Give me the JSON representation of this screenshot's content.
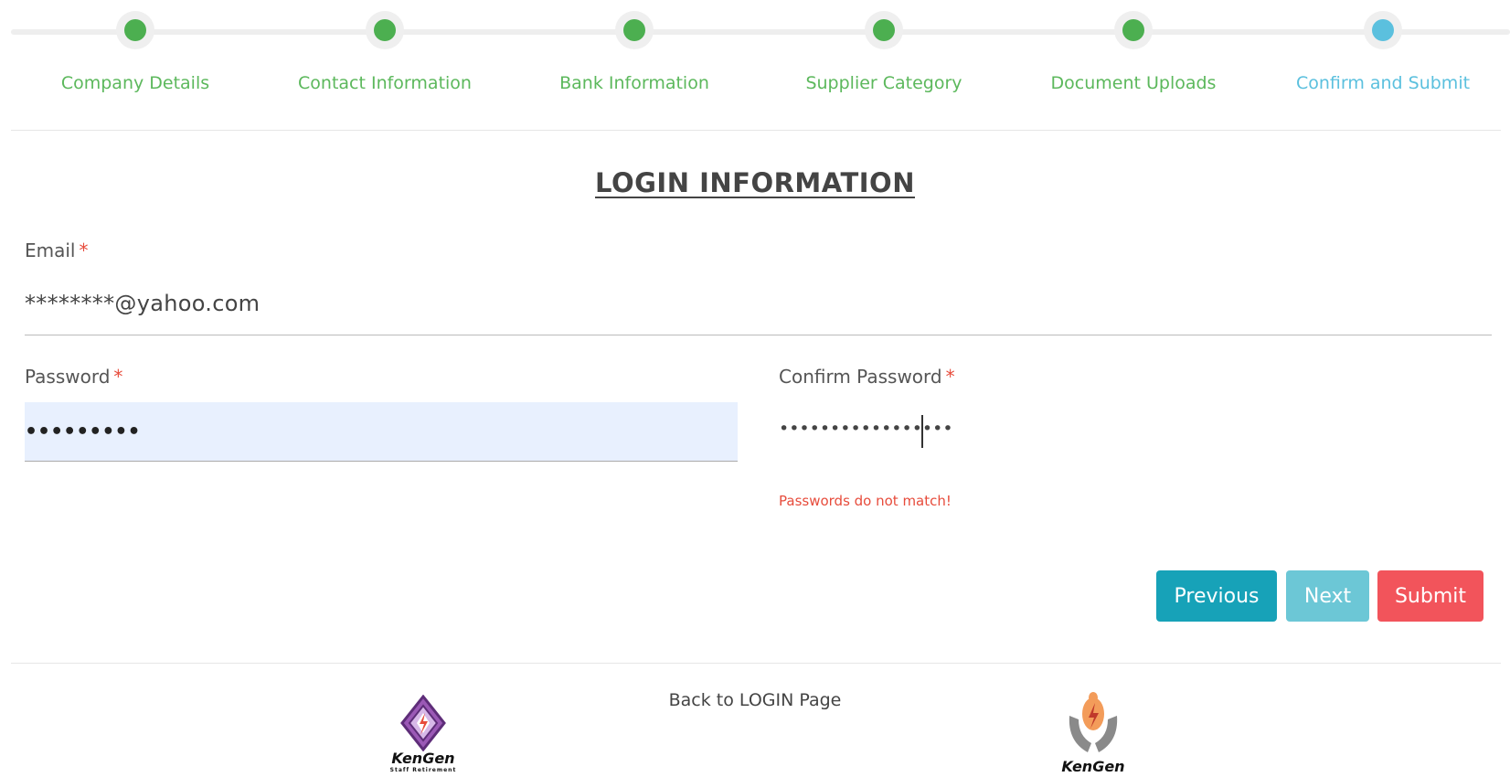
{
  "stepper": {
    "steps": [
      {
        "label": "Company Details",
        "state": "complete"
      },
      {
        "label": "Contact Information",
        "state": "complete"
      },
      {
        "label": "Bank Information",
        "state": "complete"
      },
      {
        "label": "Supplier Category",
        "state": "complete"
      },
      {
        "label": "Document Uploads",
        "state": "complete"
      },
      {
        "label": "Confirm and Submit",
        "state": "current"
      }
    ],
    "colors": {
      "complete": "#4caf50",
      "current": "#5bc0de"
    }
  },
  "form": {
    "title": "LOGIN INFORMATION",
    "email": {
      "label": "Email",
      "required_mark": "*",
      "value": "********@yahoo.com"
    },
    "password": {
      "label": "Password",
      "required_mark": "*",
      "value": "•••••••••"
    },
    "confirm_password": {
      "label": "Confirm Password",
      "required_mark": "*",
      "value": "•••••••••••••••••"
    },
    "error": "Passwords do not match!"
  },
  "buttons": {
    "previous": "Previous",
    "next": "Next",
    "submit": "Submit"
  },
  "footer": {
    "back_link": "Back to LOGIN Page",
    "logo_left": {
      "icon": "kengen-staff-retirement-logo",
      "text": "KenGen",
      "subtext": "Staff Retirement"
    },
    "logo_right": {
      "icon": "kengen-logo",
      "text": "KenGen"
    }
  }
}
